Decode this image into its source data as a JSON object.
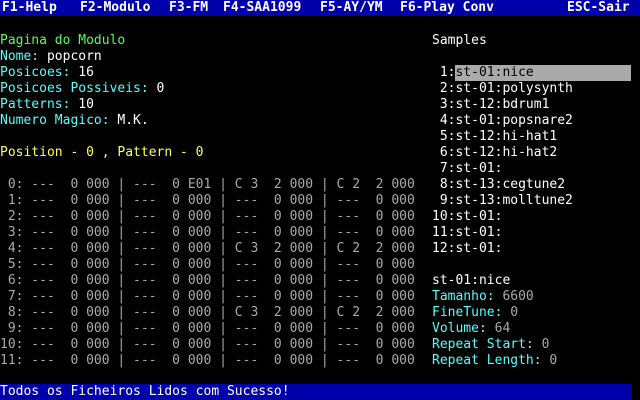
{
  "menu": [
    {
      "label": "F1-Help"
    },
    {
      "label": "F2-Modulo"
    },
    {
      "label": "F3-FM"
    },
    {
      "label": "F4-SAA1099"
    },
    {
      "label": "F5-AY/YM"
    },
    {
      "label": "F6-Play Conv"
    },
    {
      "label": "ESC-Sair"
    }
  ],
  "module": {
    "heading": "Pagina do Modulo",
    "name_label": "Nome:",
    "name_value": "popcorn",
    "positions_label": "Posicoes:",
    "positions_value": "16",
    "possible_label": "Posicoes Possiveis:",
    "possible_value": "0",
    "patterns_label": "Patterns:",
    "patterns_value": "10",
    "magic_label": "Numero Magico:",
    "magic_value": "M.K."
  },
  "position_line": "Position - 0 , Pattern - 0",
  "pattern_rows": [
    " 0: ---  0 000 | ---  0 E01 | C 3  2 000 | C 2  2 000",
    " 1: ---  0 000 | ---  0 000 | ---  0 000 | ---  0 000",
    " 2: ---  0 000 | ---  0 000 | ---  0 000 | ---  0 000",
    " 3: ---  0 000 | ---  0 000 | ---  0 000 | ---  0 000",
    " 4: ---  0 000 | ---  0 000 | C 3  2 000 | C 2  2 000",
    " 5: ---  0 000 | ---  0 000 | ---  0 000 | ---  0 000",
    " 6: ---  0 000 | ---  0 000 | ---  0 000 | ---  0 000",
    " 7: ---  0 000 | ---  0 000 | ---  0 000 | ---  0 000",
    " 8: ---  0 000 | ---  0 000 | C 3  2 000 | C 2  2 000",
    " 9: ---  0 000 | ---  0 000 | ---  0 000 | ---  0 000",
    "10: ---  0 000 | ---  0 000 | ---  0 000 | ---  0 000",
    "11: ---  0 000 | ---  0 000 | ---  0 000 | ---  0 000"
  ],
  "samples": {
    "heading": "Samples",
    "items": [
      {
        "num": " 1:",
        "name": "st-01:nice",
        "selected": true
      },
      {
        "num": " 2:",
        "name": "st-01:polysynth"
      },
      {
        "num": " 3:",
        "name": "st-12:bdrum1"
      },
      {
        "num": " 4:",
        "name": "st-01:popsnare2"
      },
      {
        "num": " 5:",
        "name": "st-12:hi-hat1"
      },
      {
        "num": " 6:",
        "name": "st-12:hi-hat2"
      },
      {
        "num": " 7:",
        "name": "st-01:"
      },
      {
        "num": " 8:",
        "name": "st-13:cegtune2"
      },
      {
        "num": " 9:",
        "name": "st-13:molltune2"
      },
      {
        "num": "10:",
        "name": "st-01:"
      },
      {
        "num": "11:",
        "name": "st-01:"
      },
      {
        "num": "12:",
        "name": "st-01:"
      }
    ]
  },
  "sample_info": {
    "name": "st-01:nice",
    "size_label": "Tamanho:",
    "size_value": "6600",
    "finetune_label": "FineTune:",
    "finetune_value": "0",
    "volume_label": "Volume:",
    "volume_value": "64",
    "repstart_label": "Repeat Start:",
    "repstart_value": "0",
    "replen_label": "Repeat Length:",
    "replen_value": "0"
  },
  "status": "Todos os Ficheiros Lidos com Sucesso!",
  "colors": {
    "menu_bg": "#0000aa",
    "label": "#55ffff",
    "heading": "#55ff55",
    "accent": "#ffff55",
    "selection": "#aaaaaa"
  }
}
